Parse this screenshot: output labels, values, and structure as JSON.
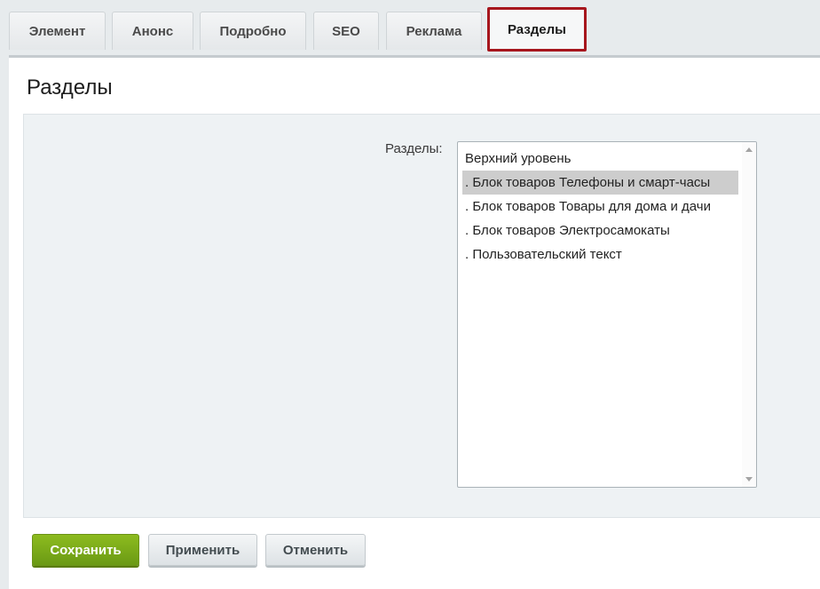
{
  "tabs": [
    {
      "label": "Элемент"
    },
    {
      "label": "Анонс"
    },
    {
      "label": "Подробно"
    },
    {
      "label": "SEO"
    },
    {
      "label": "Реклама"
    },
    {
      "label": "Разделы",
      "active": true
    }
  ],
  "panel": {
    "title": "Разделы",
    "field_label": "Разделы:",
    "sections_list": {
      "items": [
        {
          "label": "Верхний уровень",
          "selected": false
        },
        {
          "label": ". Блок товаров Телефоны и смарт-часы",
          "selected": true
        },
        {
          "label": ". Блок товаров Товары для дома и дачи",
          "selected": false
        },
        {
          "label": ". Блок товаров Электросамокаты",
          "selected": false
        },
        {
          "label": ". Пользовательский текст",
          "selected": false
        }
      ]
    }
  },
  "buttons": {
    "save": "Сохранить",
    "apply": "Применить",
    "cancel": "Отменить"
  },
  "colors": {
    "active_tab_highlight": "#a6161d",
    "save_button": "#7aab19",
    "selected_item": "#cdcdcd"
  },
  "icons": {
    "scroll_up": "triangle-up",
    "scroll_down": "triangle-down"
  }
}
